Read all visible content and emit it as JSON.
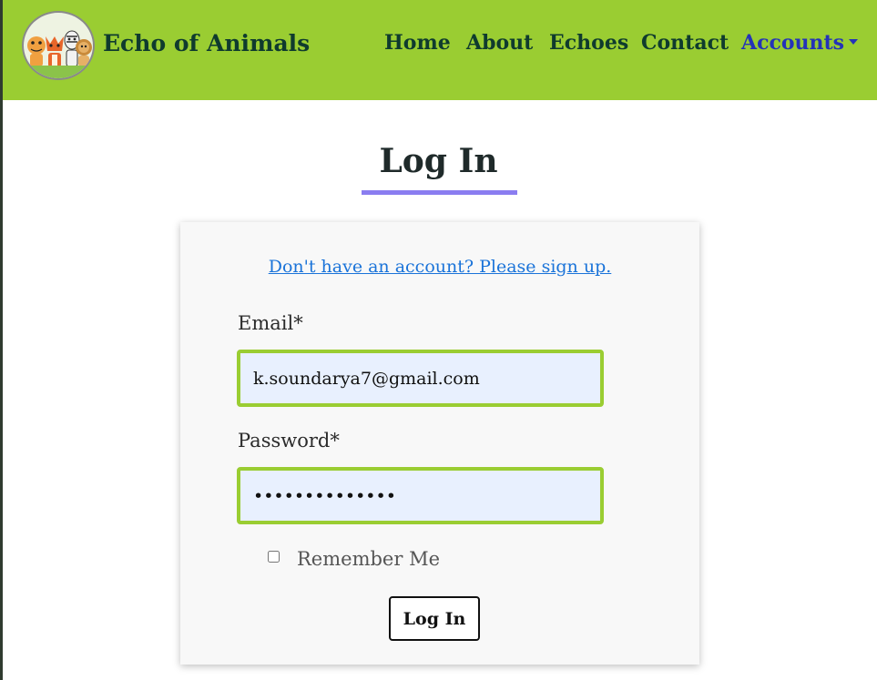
{
  "nav": {
    "brand": "Echo of Animals",
    "links": [
      {
        "label": "Home"
      },
      {
        "label": "About"
      },
      {
        "label": "Echoes"
      },
      {
        "label": "Contact"
      },
      {
        "label": "Accounts"
      }
    ],
    "accent_color": "#9acd32",
    "active_color": "#2433b8"
  },
  "page": {
    "title": "Log In",
    "underline_color": "#8a7df0"
  },
  "form": {
    "signup_link": "Don't have an account? Please sign up.",
    "email_label": "Email*",
    "email_value": "k.soundarya7@gmail.com",
    "password_label": "Password*",
    "password_value": "••••••••••••••",
    "remember_label": "Remember Me",
    "remember_checked": false,
    "submit_label": "Log In"
  },
  "icons": {
    "logo": "animals-logo-icon",
    "dropdown": "caret-down-icon"
  }
}
